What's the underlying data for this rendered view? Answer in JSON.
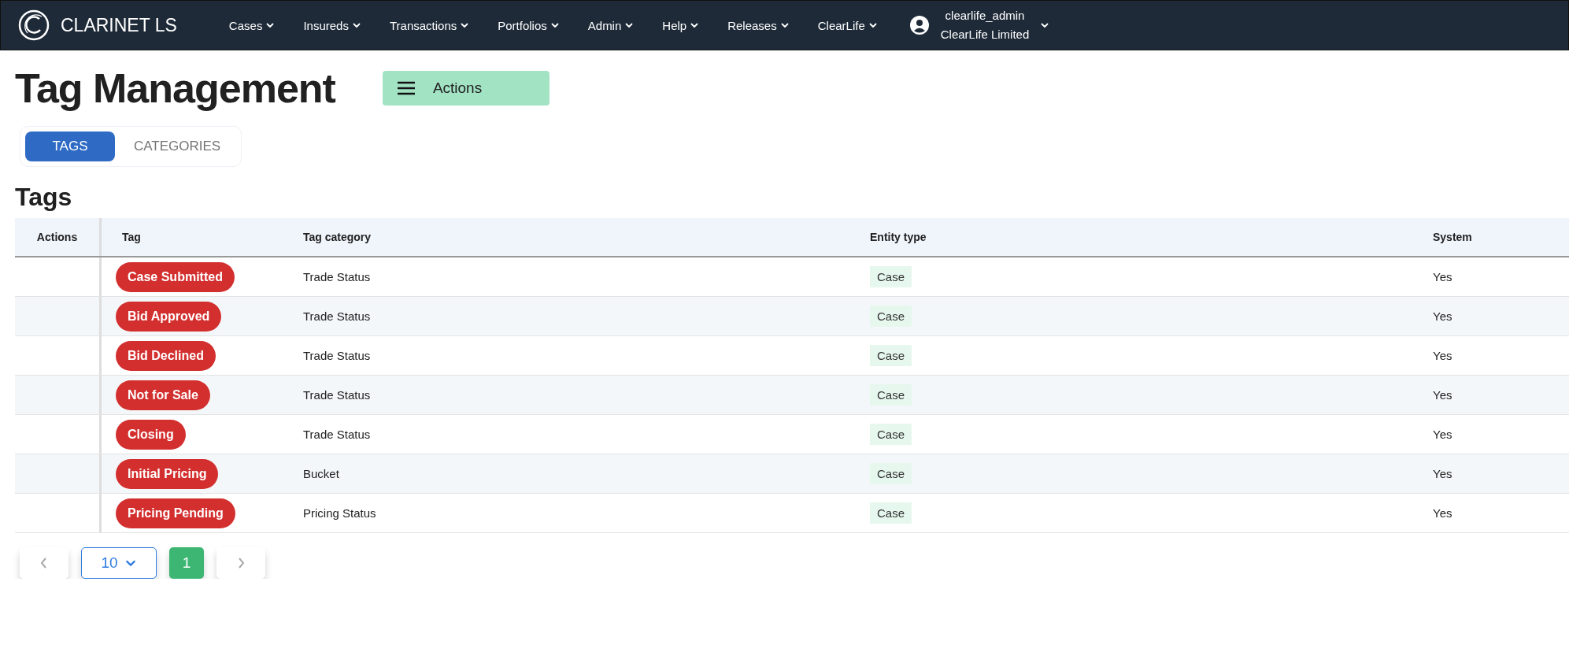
{
  "nav": {
    "brand": "CLARINET LS",
    "menus": [
      "Cases",
      "Insureds",
      "Transactions",
      "Portfolios",
      "Admin",
      "Help",
      "Releases",
      "ClearLife"
    ],
    "user": {
      "name": "clearlife_admin",
      "company": "ClearLife Limited"
    }
  },
  "page": {
    "title": "Tag Management",
    "actions_button": "Actions"
  },
  "tabs": [
    {
      "label": "TAGS",
      "selected": true
    },
    {
      "label": "CATEGORIES",
      "selected": false
    }
  ],
  "section_title": "Tags",
  "table": {
    "columns": [
      "Actions",
      "Tag",
      "Tag category",
      "Entity type",
      "System"
    ],
    "rows": [
      {
        "tag": "Case Submitted",
        "category": "Trade Status",
        "entity_type": "Case",
        "system": "Yes"
      },
      {
        "tag": "Bid Approved",
        "category": "Trade Status",
        "entity_type": "Case",
        "system": "Yes"
      },
      {
        "tag": "Bid Declined",
        "category": "Trade Status",
        "entity_type": "Case",
        "system": "Yes"
      },
      {
        "tag": "Not for Sale",
        "category": "Trade Status",
        "entity_type": "Case",
        "system": "Yes"
      },
      {
        "tag": "Closing",
        "category": "Trade Status",
        "entity_type": "Case",
        "system": "Yes"
      },
      {
        "tag": "Initial Pricing",
        "category": "Bucket",
        "entity_type": "Case",
        "system": "Yes"
      },
      {
        "tag": "Pricing Pending",
        "category": "Pricing Status",
        "entity_type": "Case",
        "system": "Yes"
      }
    ]
  },
  "pagination": {
    "page_size": "10",
    "pages": [
      {
        "label": "1",
        "selected": true
      }
    ]
  }
}
